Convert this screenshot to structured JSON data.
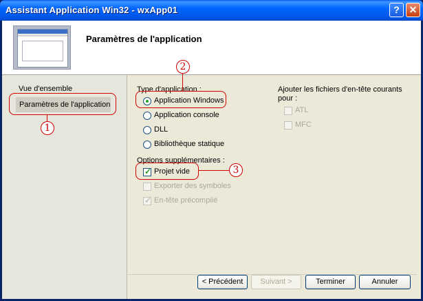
{
  "window": {
    "title": "Assistant Application Win32 - wxApp01"
  },
  "header": {
    "title": "Paramètres de l'application"
  },
  "nav": {
    "overview": "Vue d'ensemble",
    "active": "Paramètres de l'application"
  },
  "app_type": {
    "label": "Type d'application :",
    "options": [
      "Application Windows",
      "Application console",
      "DLL",
      "Bibliothèque statique"
    ],
    "selected": "Application Windows"
  },
  "extra": {
    "label": "Options supplémentaires :",
    "items": [
      {
        "label": "Projet vide",
        "checked": true,
        "enabled": true
      },
      {
        "label": "Exporter des symboles",
        "checked": false,
        "enabled": false
      },
      {
        "label": "En-tête précompilé",
        "checked": true,
        "enabled": false
      }
    ]
  },
  "headers": {
    "label_line1": "Ajouter les fichiers d'en-tête courants",
    "label_line2": "pour :",
    "items": [
      {
        "label": "ATL",
        "checked": false,
        "enabled": false
      },
      {
        "label": "MFC",
        "checked": false,
        "enabled": false
      }
    ]
  },
  "buttons": {
    "prev": "< Précédent",
    "next": "Suivant >",
    "finish": "Terminer",
    "cancel": "Annuler"
  },
  "annotations": [
    "1",
    "2",
    "3"
  ],
  "colors": {
    "annotation": "#d00000",
    "titlebar": "#0058ee",
    "check": "#21a121"
  }
}
